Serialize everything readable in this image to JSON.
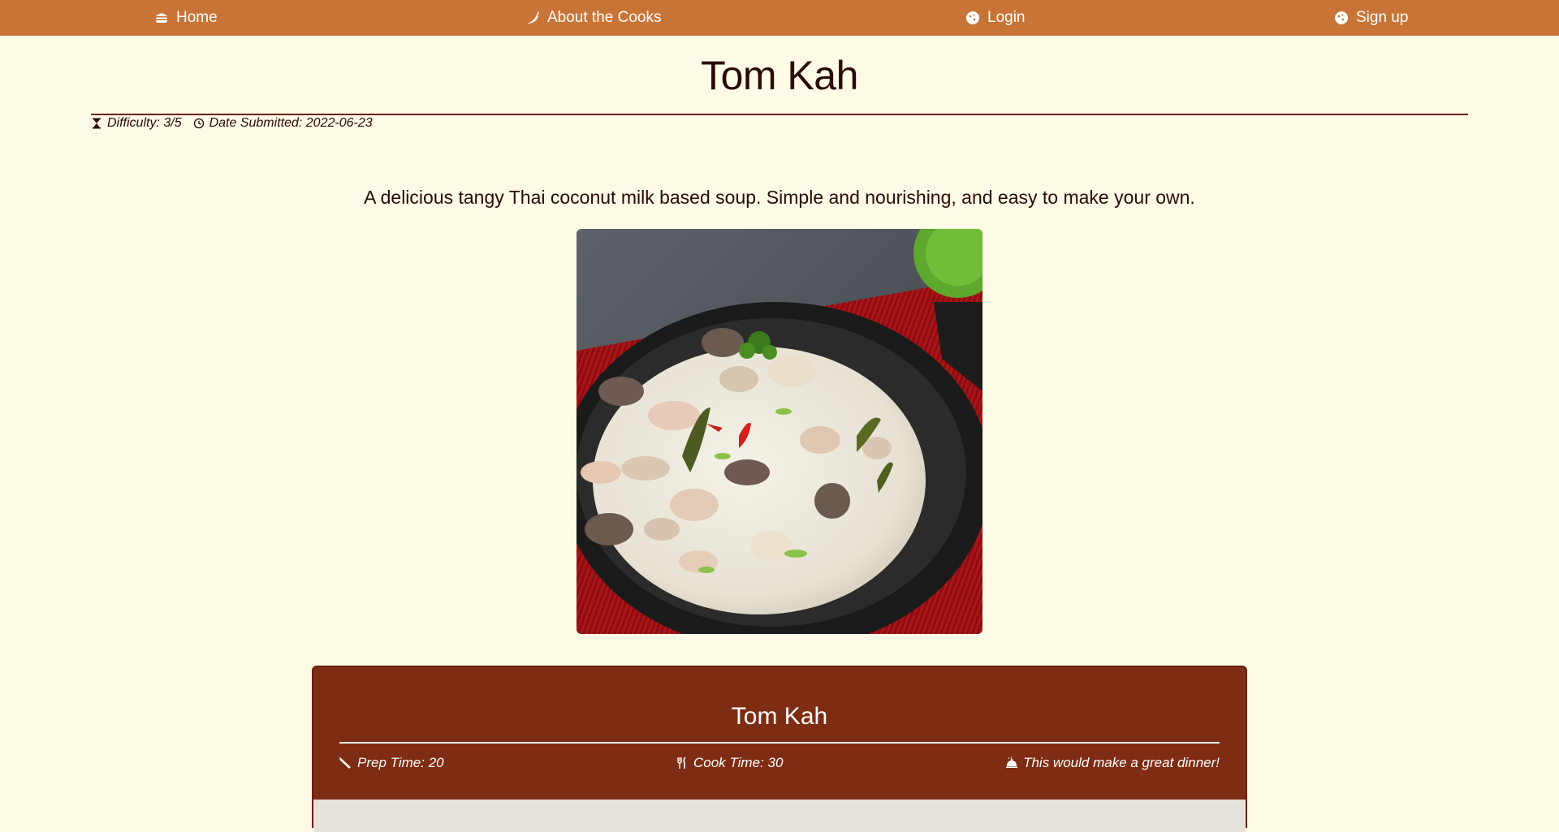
{
  "nav": {
    "items": [
      {
        "label": "Home",
        "icon": "burger-icon"
      },
      {
        "label": "About the Cooks",
        "icon": "chili-icon"
      },
      {
        "label": "Login",
        "icon": "cookie-icon"
      },
      {
        "label": "Sign up",
        "icon": "cookie-icon"
      }
    ]
  },
  "recipe": {
    "title": "Tom Kah",
    "difficulty": "Difficulty: 3/5",
    "date_submitted": "Date Submitted: 2022-06-23",
    "description": "A delicious tangy Thai coconut milk based soup. Simple and nourishing, and easy to make your own.",
    "image_alt": "Tom Kah soup in a black bowl"
  },
  "card": {
    "title": "Tom Kah",
    "prep_time": "Prep Time: 20",
    "cook_time": "Cook Time: 30",
    "meal_note": "This would make a great dinner!"
  },
  "colors": {
    "navbar": "#c87437",
    "background": "#fdfbe6",
    "card": "#7e2c13",
    "text": "#2a0a06"
  }
}
